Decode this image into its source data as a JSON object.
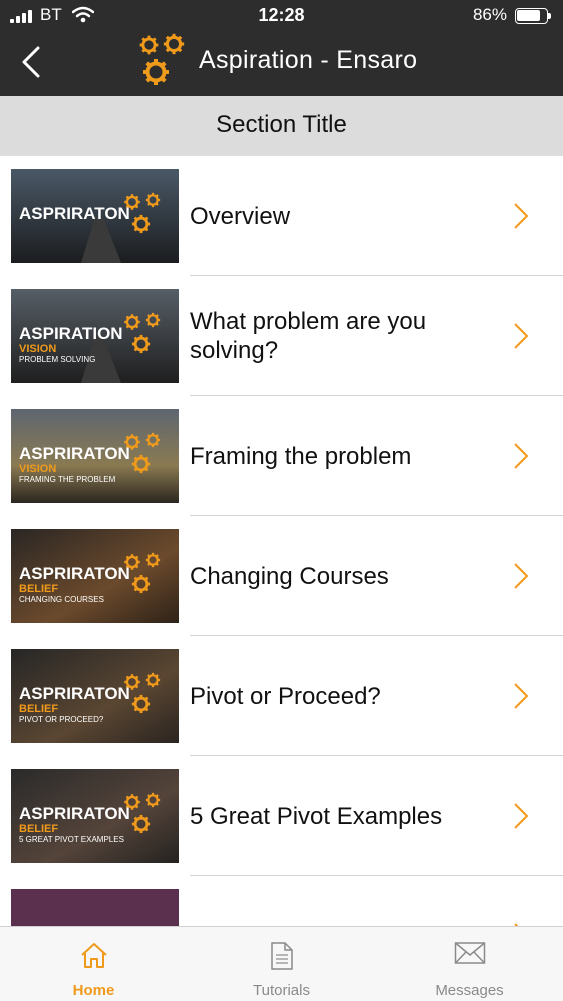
{
  "status": {
    "carrier": "BT",
    "time": "12:28",
    "battery": "86%",
    "battery_level": 0.86
  },
  "nav": {
    "title": "Aspiration - Ensaro"
  },
  "section": {
    "title": "Section Title"
  },
  "items": [
    {
      "label": "Overview",
      "thumb_title": "ASPRIRATON",
      "thumb_sub1": "",
      "thumb_sub2": ""
    },
    {
      "label": "What problem are you solving?",
      "thumb_title": "ASPIRATION",
      "thumb_sub1": "VISION",
      "thumb_sub2": "PROBLEM SOLVING"
    },
    {
      "label": "Framing the problem",
      "thumb_title": "ASPRIRATON",
      "thumb_sub1": "VISION",
      "thumb_sub2": "FRAMING THE PROBLEM"
    },
    {
      "label": "Changing Courses",
      "thumb_title": "ASPRIRATON",
      "thumb_sub1": "BELIEF",
      "thumb_sub2": "CHANGING COURSES"
    },
    {
      "label": "Pivot or Proceed?",
      "thumb_title": "ASPRIRATON",
      "thumb_sub1": "BELIEF",
      "thumb_sub2": "PIVOT OR PROCEED?"
    },
    {
      "label": "5 Great Pivot Examples",
      "thumb_title": "ASPRIRATON",
      "thumb_sub1": "BELIEF",
      "thumb_sub2": "5 GREAT PIVOT EXAMPLES"
    }
  ],
  "tabs": [
    {
      "label": "Home",
      "icon": "home-icon",
      "active": true
    },
    {
      "label": "Tutorials",
      "icon": "document-icon",
      "active": false
    },
    {
      "label": "Messages",
      "icon": "mail-icon",
      "active": false
    }
  ],
  "colors": {
    "accent": "#f09a1c",
    "header": "#2d2d2d",
    "section_bg": "#dcdcdc"
  }
}
